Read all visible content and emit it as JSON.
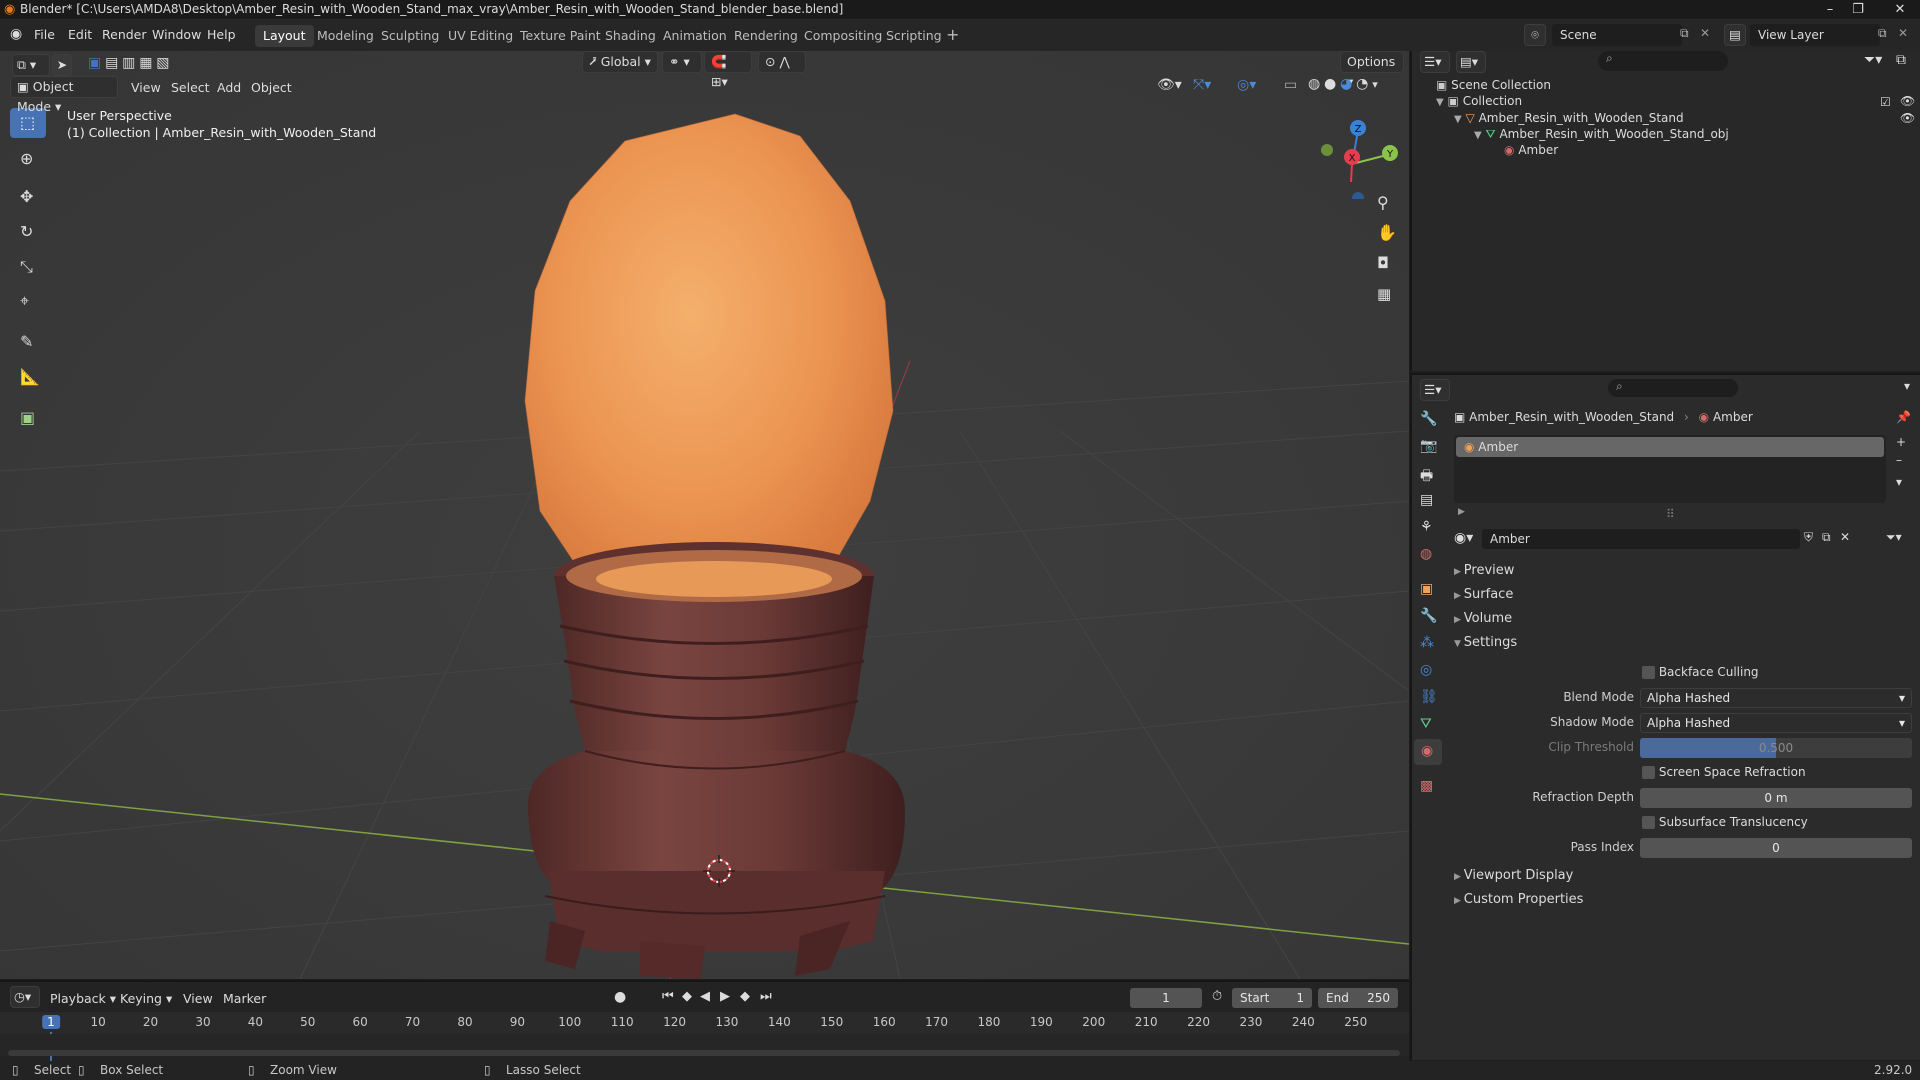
{
  "titlebar": {
    "title": "Blender* [C:\\Users\\AMDA8\\Desktop\\Amber_Resin_with_Wooden_Stand_max_vray\\Amber_Resin_with_Wooden_Stand_blender_base.blend]"
  },
  "menu": [
    "File",
    "Edit",
    "Render",
    "Window",
    "Help"
  ],
  "workspaces": [
    "Layout",
    "Modeling",
    "Sculpting",
    "UV Editing",
    "Texture Paint",
    "Shading",
    "Animation",
    "Rendering",
    "Compositing",
    "Scripting"
  ],
  "active_workspace": "Layout",
  "scene": {
    "label": "Scene"
  },
  "view_layer": {
    "label": "View Layer"
  },
  "viewport": {
    "mode": "Object Mode",
    "menus": [
      "View",
      "Select",
      "Add",
      "Object"
    ],
    "transform_orientation": "Global",
    "options_label": "Options",
    "info_line1": "User Perspective",
    "info_line2": "(1) Collection | Amber_Resin_with_Wooden_Stand",
    "gizmo_axes": {
      "x": "X",
      "y": "Y",
      "z": "Z"
    }
  },
  "outliner": {
    "root": "Scene Collection",
    "collection": "Collection",
    "object": "Amber_Resin_with_Wooden_Stand",
    "mesh": "Amber_Resin_with_Wooden_Stand_obj",
    "material": "Amber"
  },
  "properties": {
    "breadcrumb_object": "Amber_Resin_with_Wooden_Stand",
    "breadcrumb_material": "Amber",
    "slot_name": "Amber",
    "material_name": "Amber",
    "sections": {
      "preview": "Preview",
      "surface": "Surface",
      "volume": "Volume",
      "settings": "Settings",
      "viewport_display": "Viewport Display",
      "custom_properties": "Custom Properties"
    },
    "settings": {
      "backface_culling": "Backface Culling",
      "blend_mode_label": "Blend Mode",
      "blend_mode_value": "Alpha Hashed",
      "shadow_mode_label": "Shadow Mode",
      "shadow_mode_value": "Alpha Hashed",
      "clip_threshold_label": "Clip Threshold",
      "clip_threshold_value": "0.500",
      "clip_threshold_fraction": 0.5,
      "screen_space_refraction": "Screen Space Refraction",
      "refraction_depth_label": "Refraction Depth",
      "refraction_depth_value": "0 m",
      "subsurface_translucency": "Subsurface Translucency",
      "pass_index_label": "Pass Index",
      "pass_index_value": "0"
    }
  },
  "timeline": {
    "menus": [
      "Playback",
      "Keying",
      "View",
      "Marker"
    ],
    "current_frame": "1",
    "start_label": "Start",
    "start_value": "1",
    "end_label": "End",
    "end_value": "250",
    "ticks": [
      "1",
      "10",
      "20",
      "30",
      "40",
      "50",
      "60",
      "70",
      "80",
      "90",
      "100",
      "110",
      "120",
      "130",
      "140",
      "150",
      "160",
      "170",
      "180",
      "190",
      "200",
      "210",
      "220",
      "230",
      "240",
      "250"
    ]
  },
  "statusbar": {
    "select": "Select",
    "box_select": "Box Select",
    "zoom_view": "Zoom View",
    "lasso_select": "Lasso Select",
    "version": "2.92.0"
  },
  "colors": {
    "accent": "#4772b3",
    "amber": "#f0a25a",
    "wood": "#6b3a37",
    "x_axis": "#e33d4f",
    "y_axis": "#8bc34a",
    "z_axis": "#3b82d6"
  }
}
